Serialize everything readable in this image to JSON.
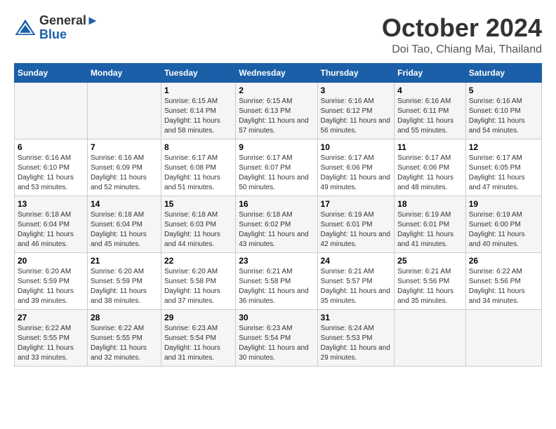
{
  "header": {
    "logo_line1": "General",
    "logo_line2": "Blue",
    "month": "October 2024",
    "location": "Doi Tao, Chiang Mai, Thailand"
  },
  "days_of_week": [
    "Sunday",
    "Monday",
    "Tuesday",
    "Wednesday",
    "Thursday",
    "Friday",
    "Saturday"
  ],
  "weeks": [
    [
      {
        "day": "",
        "info": ""
      },
      {
        "day": "",
        "info": ""
      },
      {
        "day": "1",
        "info": "Sunrise: 6:15 AM\nSunset: 6:14 PM\nDaylight: 11 hours and 58 minutes."
      },
      {
        "day": "2",
        "info": "Sunrise: 6:15 AM\nSunset: 6:13 PM\nDaylight: 11 hours and 57 minutes."
      },
      {
        "day": "3",
        "info": "Sunrise: 6:16 AM\nSunset: 6:12 PM\nDaylight: 11 hours and 56 minutes."
      },
      {
        "day": "4",
        "info": "Sunrise: 6:16 AM\nSunset: 6:11 PM\nDaylight: 11 hours and 55 minutes."
      },
      {
        "day": "5",
        "info": "Sunrise: 6:16 AM\nSunset: 6:10 PM\nDaylight: 11 hours and 54 minutes."
      }
    ],
    [
      {
        "day": "6",
        "info": "Sunrise: 6:16 AM\nSunset: 6:10 PM\nDaylight: 11 hours and 53 minutes."
      },
      {
        "day": "7",
        "info": "Sunrise: 6:16 AM\nSunset: 6:09 PM\nDaylight: 11 hours and 52 minutes."
      },
      {
        "day": "8",
        "info": "Sunrise: 6:17 AM\nSunset: 6:08 PM\nDaylight: 11 hours and 51 minutes."
      },
      {
        "day": "9",
        "info": "Sunrise: 6:17 AM\nSunset: 6:07 PM\nDaylight: 11 hours and 50 minutes."
      },
      {
        "day": "10",
        "info": "Sunrise: 6:17 AM\nSunset: 6:06 PM\nDaylight: 11 hours and 49 minutes."
      },
      {
        "day": "11",
        "info": "Sunrise: 6:17 AM\nSunset: 6:06 PM\nDaylight: 11 hours and 48 minutes."
      },
      {
        "day": "12",
        "info": "Sunrise: 6:17 AM\nSunset: 6:05 PM\nDaylight: 11 hours and 47 minutes."
      }
    ],
    [
      {
        "day": "13",
        "info": "Sunrise: 6:18 AM\nSunset: 6:04 PM\nDaylight: 11 hours and 46 minutes."
      },
      {
        "day": "14",
        "info": "Sunrise: 6:18 AM\nSunset: 6:04 PM\nDaylight: 11 hours and 45 minutes."
      },
      {
        "day": "15",
        "info": "Sunrise: 6:18 AM\nSunset: 6:03 PM\nDaylight: 11 hours and 44 minutes."
      },
      {
        "day": "16",
        "info": "Sunrise: 6:18 AM\nSunset: 6:02 PM\nDaylight: 11 hours and 43 minutes."
      },
      {
        "day": "17",
        "info": "Sunrise: 6:19 AM\nSunset: 6:01 PM\nDaylight: 11 hours and 42 minutes."
      },
      {
        "day": "18",
        "info": "Sunrise: 6:19 AM\nSunset: 6:01 PM\nDaylight: 11 hours and 41 minutes."
      },
      {
        "day": "19",
        "info": "Sunrise: 6:19 AM\nSunset: 6:00 PM\nDaylight: 11 hours and 40 minutes."
      }
    ],
    [
      {
        "day": "20",
        "info": "Sunrise: 6:20 AM\nSunset: 5:59 PM\nDaylight: 11 hours and 39 minutes."
      },
      {
        "day": "21",
        "info": "Sunrise: 6:20 AM\nSunset: 5:59 PM\nDaylight: 11 hours and 38 minutes."
      },
      {
        "day": "22",
        "info": "Sunrise: 6:20 AM\nSunset: 5:58 PM\nDaylight: 11 hours and 37 minutes."
      },
      {
        "day": "23",
        "info": "Sunrise: 6:21 AM\nSunset: 5:58 PM\nDaylight: 11 hours and 36 minutes."
      },
      {
        "day": "24",
        "info": "Sunrise: 6:21 AM\nSunset: 5:57 PM\nDaylight: 11 hours and 35 minutes."
      },
      {
        "day": "25",
        "info": "Sunrise: 6:21 AM\nSunset: 5:56 PM\nDaylight: 11 hours and 35 minutes."
      },
      {
        "day": "26",
        "info": "Sunrise: 6:22 AM\nSunset: 5:56 PM\nDaylight: 11 hours and 34 minutes."
      }
    ],
    [
      {
        "day": "27",
        "info": "Sunrise: 6:22 AM\nSunset: 5:55 PM\nDaylight: 11 hours and 33 minutes."
      },
      {
        "day": "28",
        "info": "Sunrise: 6:22 AM\nSunset: 5:55 PM\nDaylight: 11 hours and 32 minutes."
      },
      {
        "day": "29",
        "info": "Sunrise: 6:23 AM\nSunset: 5:54 PM\nDaylight: 11 hours and 31 minutes."
      },
      {
        "day": "30",
        "info": "Sunrise: 6:23 AM\nSunset: 5:54 PM\nDaylight: 11 hours and 30 minutes."
      },
      {
        "day": "31",
        "info": "Sunrise: 6:24 AM\nSunset: 5:53 PM\nDaylight: 11 hours and 29 minutes."
      },
      {
        "day": "",
        "info": ""
      },
      {
        "day": "",
        "info": ""
      }
    ]
  ]
}
